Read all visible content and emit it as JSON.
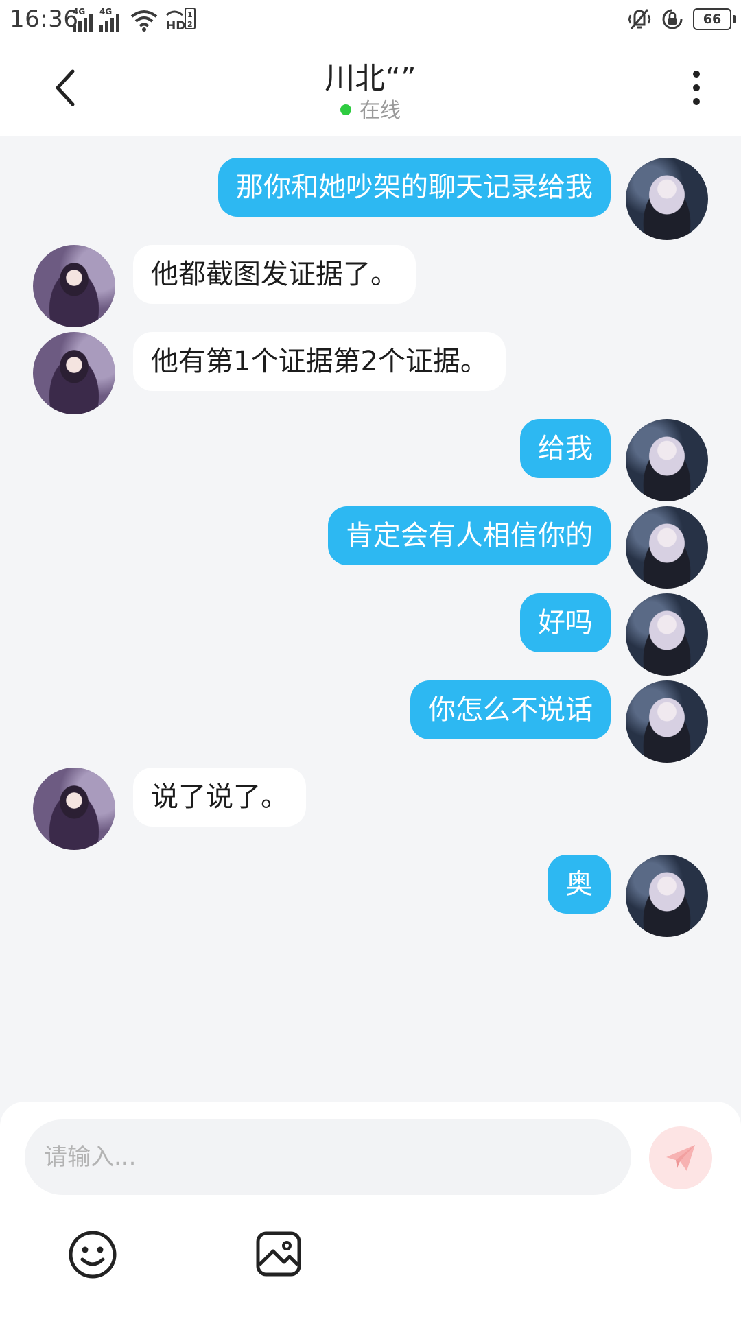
{
  "status_bar": {
    "time": "16:36",
    "network_1": "4G",
    "network_2": "4G",
    "battery": "66",
    "icons": [
      "signal-icon",
      "signal-icon",
      "wifi-icon",
      "hd-icon",
      "vibrate-icon",
      "rotation-lock-icon",
      "battery-icon"
    ]
  },
  "header": {
    "title": "川北“”",
    "status": "在线",
    "icons": {
      "back": "chevron-left-icon",
      "more": "more-vertical-icon"
    }
  },
  "messages": [
    {
      "side": "right",
      "text": "那你和她吵架的聊天记录给我"
    },
    {
      "side": "left",
      "text": "他都截图发证据了。"
    },
    {
      "side": "left",
      "text": "他有第1个证据第2个证据。"
    },
    {
      "side": "right",
      "text": "给我"
    },
    {
      "side": "right",
      "text": "肯定会有人相信你的"
    },
    {
      "side": "right",
      "text": "好吗"
    },
    {
      "side": "right",
      "text": "你怎么不说话"
    },
    {
      "side": "left",
      "text": "说了说了。"
    },
    {
      "side": "right",
      "text": "奥"
    }
  ],
  "input": {
    "placeholder": "请输入...",
    "value": "",
    "send_icon": "paper-plane-icon",
    "emoji_icon": "smile-icon",
    "image_icon": "image-icon"
  },
  "colors": {
    "own_bubble": "#2db8f2",
    "other_bubble": "#ffffff",
    "chat_background": "#f4f5f7",
    "online_dot": "#2ecc40",
    "send_button": "#fde4e4",
    "send_icon": "#f7b2b2"
  }
}
